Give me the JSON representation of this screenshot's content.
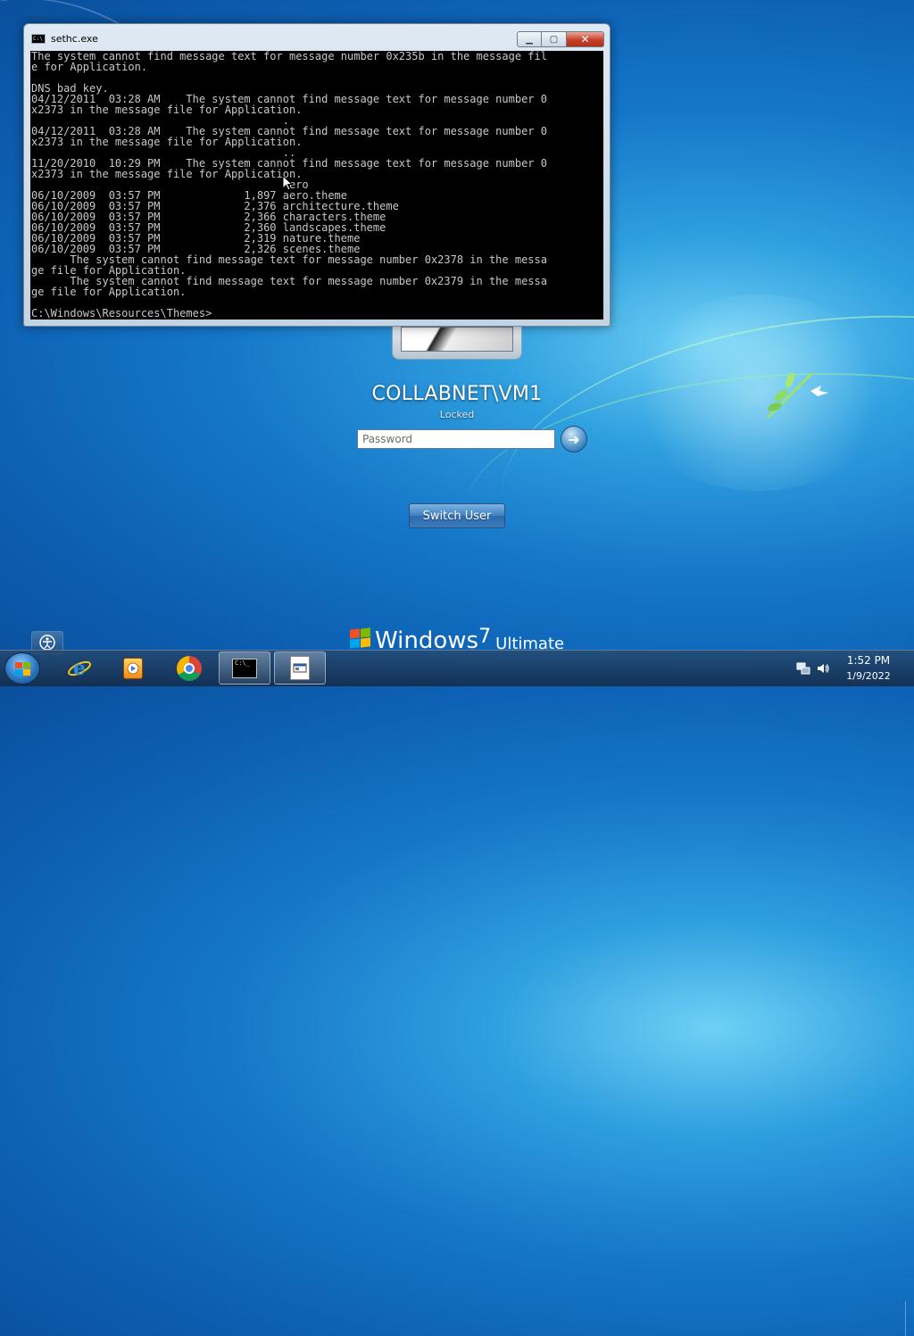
{
  "console": {
    "title": "sethc.exe",
    "lines": [
      "The system cannot find message text for message number 0x235b in the message fil",
      "e for Application.",
      "",
      "DNS bad key.",
      "04/12/2011  03:28 AM    The system cannot find message text for message number 0",
      "x2373 in the message file for Application.",
      "                                       .",
      "04/12/2011  03:28 AM    The system cannot find message text for message number 0",
      "x2373 in the message file for Application.",
      "                                       ..",
      "11/20/2010  10:29 PM    The system cannot find message text for message number 0",
      "x2373 in the message file for Application.",
      "                                       Aero",
      "06/10/2009  03:57 PM             1,897 aero.theme",
      "06/10/2009  03:57 PM             2,376 architecture.theme",
      "06/10/2009  03:57 PM             2,366 characters.theme",
      "06/10/2009  03:57 PM             2,360 landscapes.theme",
      "06/10/2009  03:57 PM             2,319 nature.theme",
      "06/10/2009  03:57 PM             2,326 scenes.theme",
      "      The system cannot find message text for message number 0x2378 in the messa",
      "ge file for Application.",
      "      The system cannot find message text for message number 0x2379 in the messa",
      "ge file for Application.",
      "",
      "C:\\Windows\\Resources\\Themes>"
    ],
    "minimize_symbol": "▁",
    "maximize_symbol": "▢",
    "close_symbol": "✕",
    "icon_text": "C:\\"
  },
  "login": {
    "user_name": "COLLABNET\\VM1",
    "status": "Locked",
    "password_placeholder": "Password",
    "submit_symbol": "➜",
    "switch_user_label": "Switch User"
  },
  "branding": {
    "word": "Windows",
    "version": "7",
    "edition": "Ultimate"
  },
  "taskbar": {
    "cmd_icon_text": "C:\\_",
    "clock_time": "1:52 PM",
    "clock_date": "1/9/2022"
  },
  "colors": {
    "console_bg": "#000000",
    "console_text": "#c8c8c8",
    "flag_red": "#f25022",
    "flag_green": "#7fba00",
    "flag_blue": "#00a4ef",
    "flag_yellow": "#ffb900"
  },
  "icons": {
    "start": "windows-flag-icon",
    "browser_ie": "internet-explorer-icon",
    "media": "media-player-icon",
    "browser_chrome": "chrome-icon",
    "terminal": "command-prompt-icon",
    "executable": "executable-icon"
  }
}
